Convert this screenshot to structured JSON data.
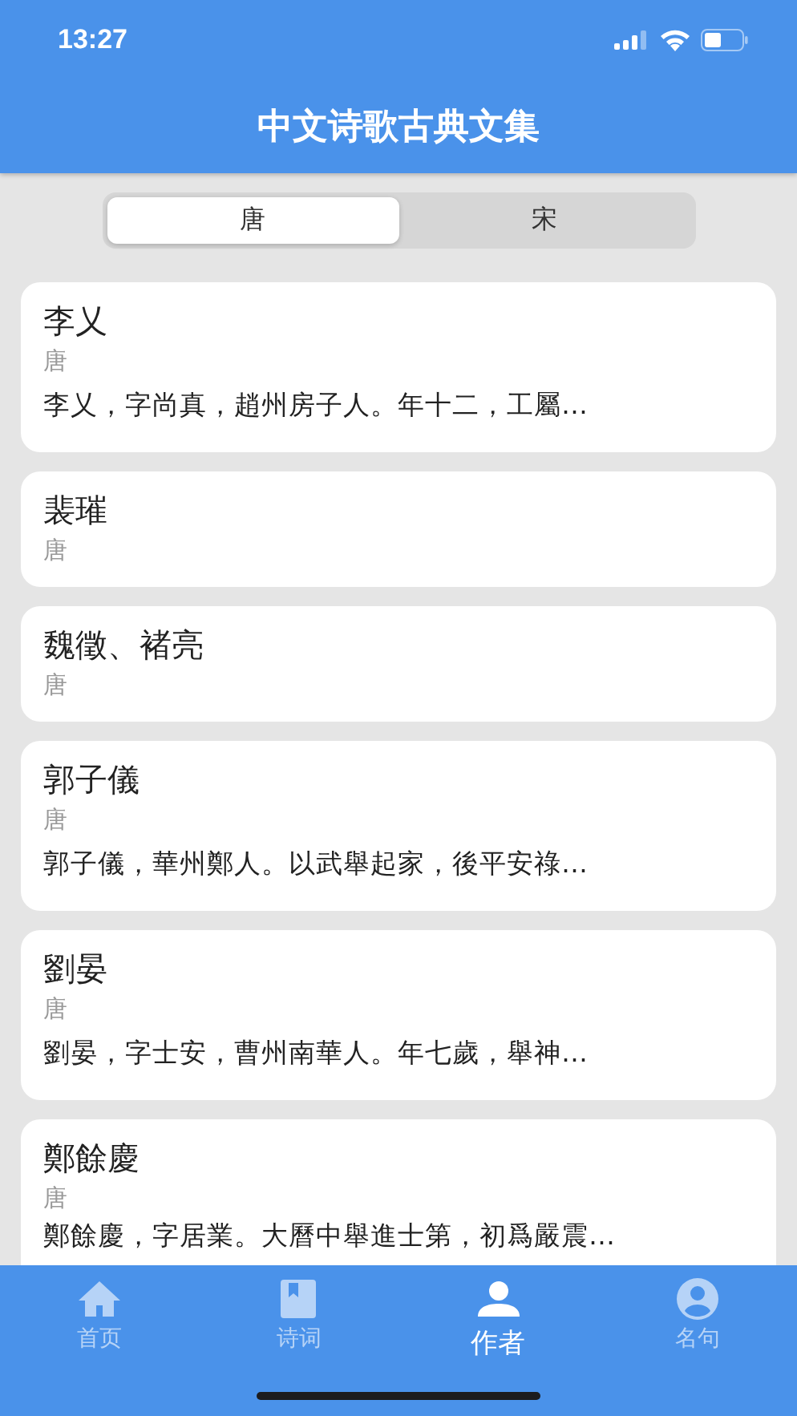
{
  "status_bar": {
    "time": "13:27"
  },
  "header": {
    "title": "中文诗歌古典文集"
  },
  "segments": [
    {
      "label": "唐",
      "selected": true
    },
    {
      "label": "宋",
      "selected": false
    }
  ],
  "authors": [
    {
      "name": "李乂",
      "dynasty": "唐",
      "description": "李乂，字尚真，趙州房子人。年十二，工屬…"
    },
    {
      "name": "裴璀",
      "dynasty": "唐"
    },
    {
      "name": "魏徵、褚亮",
      "dynasty": "唐"
    },
    {
      "name": "郭子儀",
      "dynasty": "唐",
      "description": "郭子儀，華州鄭人。以武舉起家，後平安祿…"
    },
    {
      "name": "劉晏",
      "dynasty": "唐",
      "description": "劉晏，字士安，曹州南華人。年七歲，舉神…"
    },
    {
      "name": "鄭餘慶",
      "dynasty": "唐",
      "description": "鄭餘慶，字居業。大曆中舉進士第，初爲嚴震…"
    }
  ],
  "tab_bar": [
    {
      "kind": "home",
      "label": "首页",
      "selected": false
    },
    {
      "kind": "book",
      "label": "诗词",
      "selected": false
    },
    {
      "kind": "person",
      "label": "作者",
      "selected": true
    },
    {
      "kind": "profile",
      "label": "名句",
      "selected": false
    }
  ]
}
